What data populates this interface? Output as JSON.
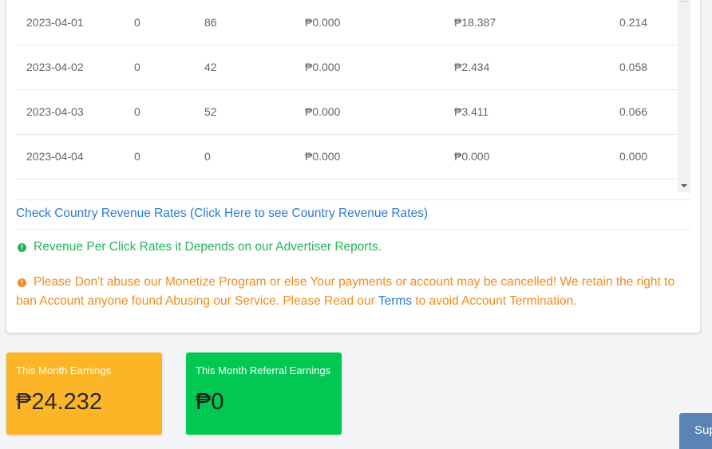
{
  "table": {
    "rows": [
      {
        "date": "2023-04-01",
        "c1": "0",
        "c2": "86",
        "c3": "₱0.000",
        "c4": "₱18.387",
        "c5": "0.214"
      },
      {
        "date": "2023-04-02",
        "c1": "0",
        "c2": "42",
        "c3": "₱0.000",
        "c4": "₱2.434",
        "c5": "0.058"
      },
      {
        "date": "2023-04-03",
        "c1": "0",
        "c2": "52",
        "c3": "₱0.000",
        "c4": "₱3.411",
        "c5": "0.066"
      },
      {
        "date": "2023-04-04",
        "c1": "0",
        "c2": "0",
        "c3": "₱0.000",
        "c4": "₱0.000",
        "c5": "0.000"
      }
    ]
  },
  "country_rates_link": "Check Country Revenue Rates (Click Here to see Country Revenue Rates)",
  "notices": {
    "rpc": "Revenue Per Click Rates it Depends on our Advertiser Reports.",
    "abuse_before": "Please Don't abuse our Monetize Program or else Your payments or account may be cancelled! We retain the right to ban Account anyone found Abusing our Service. Please Read our ",
    "terms_link": "Terms",
    "abuse_after": " to avoid Account Termination.",
    "icon": "!"
  },
  "stats": {
    "month_earnings": {
      "label": "This Month Earnings",
      "value": "₱24.232",
      "color": "#fbb527"
    },
    "referral_earnings": {
      "label": "This Month Referral Earnings",
      "value": "₱0",
      "color": "#00c853"
    }
  },
  "support_button": "Sup"
}
